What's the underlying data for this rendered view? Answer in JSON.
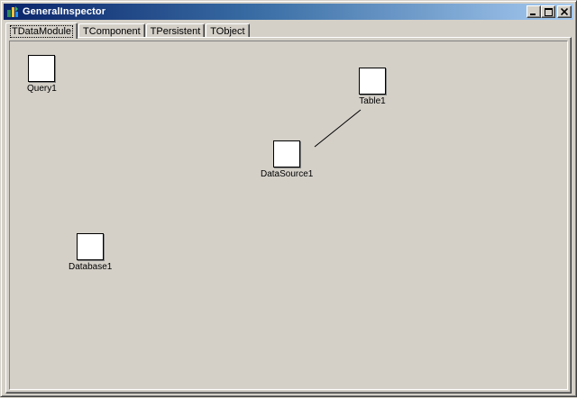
{
  "window": {
    "title": "GeneralInspector",
    "minimize_label": "_",
    "maximize_label": "□",
    "close_label": "×"
  },
  "tabs": [
    {
      "label": "TDataModule",
      "active": true
    },
    {
      "label": "TComponent",
      "active": false
    },
    {
      "label": "TPersistent",
      "active": false
    },
    {
      "label": "TObject",
      "active": false
    }
  ],
  "components": {
    "query": {
      "label": "Query1"
    },
    "table": {
      "label": "Table1"
    },
    "datasource": {
      "label": "DataSource1"
    },
    "database": {
      "label": "Database1"
    }
  },
  "links": [
    {
      "from": "datasource",
      "to": "table"
    }
  ],
  "colors": {
    "face": "#d4d0c8",
    "title_start": "#0a246a",
    "title_end": "#a6caf0",
    "box_fill": "#ffffff"
  }
}
